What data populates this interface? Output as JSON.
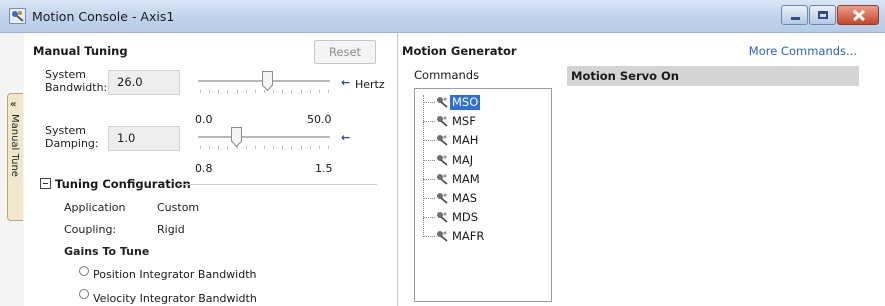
{
  "window": {
    "title": "Motion Console - Axis1",
    "controls": [
      "minimize",
      "maximize",
      "close"
    ]
  },
  "side_tab": {
    "label": "Manual Tune",
    "icon": "double-chevron-left-icon"
  },
  "manual_tuning": {
    "title": "Manual Tuning",
    "reset_label": "Reset",
    "reset_enabled": false,
    "bandwidth": {
      "label_line1": "System",
      "label_line2": "Bandwidth:",
      "value": "26.0",
      "unit": "Hertz",
      "min_label": "0.0",
      "max_label": "50.0",
      "level": 0.52
    },
    "damping": {
      "label_line1": "System",
      "label_line2": "Damping:",
      "value": "1.0",
      "min_label": "0.8",
      "max_label": "1.5",
      "level": 0.29
    },
    "tuning_config": {
      "title": "Tuning Configuration",
      "application_label": "Application",
      "application_value": "Custom",
      "coupling_label": "Coupling:",
      "coupling_value": "Rigid",
      "gains_title": "Gains To Tune",
      "gains": [
        {
          "label": "Position Integrator Bandwidth",
          "selected": false
        },
        {
          "label": "Velocity Integrator Bandwidth",
          "selected": false
        }
      ]
    }
  },
  "motion_generator": {
    "title": "Motion Generator",
    "more_commands": "More Commands...",
    "commands_label": "Commands",
    "selected_command_title": "Motion Servo On",
    "commands": [
      "MSO",
      "MSF",
      "MAH",
      "MAJ",
      "MAM",
      "MAS",
      "MDS",
      "MAFR"
    ],
    "selected_index": 0
  },
  "colors": {
    "selection": "#2f6fd6",
    "link": "#2a63c5",
    "arrow": "#1f4fa8",
    "titlebar": "#c3d5ec"
  }
}
